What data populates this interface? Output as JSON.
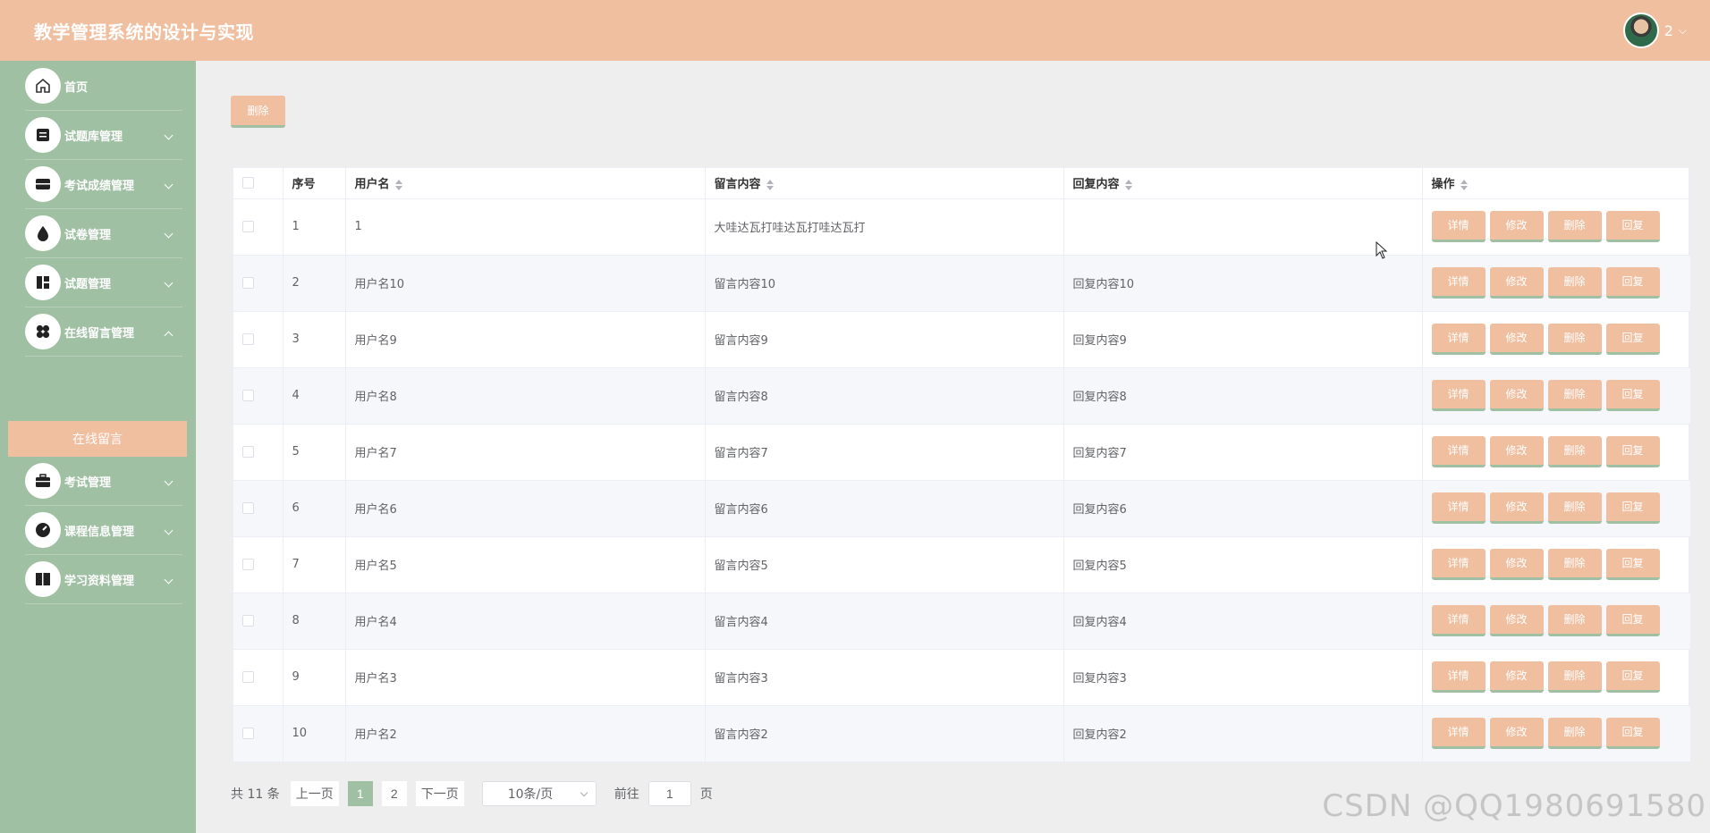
{
  "header": {
    "title": "教学管理系统的设计与实现",
    "user_name": "2",
    "user_caret": "⌵"
  },
  "sidebar": {
    "items": [
      {
        "label": "首页",
        "icon": "home-icon"
      },
      {
        "label": "试题库管理",
        "icon": "database-icon"
      },
      {
        "label": "考试成绩管理",
        "icon": "tray-icon"
      },
      {
        "label": "试卷管理",
        "icon": "drop-icon"
      },
      {
        "label": "试题管理",
        "icon": "layout-icon"
      },
      {
        "label": "在线留言管理",
        "icon": "clover-icon"
      },
      {
        "label": "考试管理",
        "icon": "briefcase-icon"
      },
      {
        "label": "课程信息管理",
        "icon": "gauge-icon"
      },
      {
        "label": "学习资料管理",
        "icon": "panel-icon"
      }
    ],
    "sub_item": "在线留言"
  },
  "toolbar": {
    "delete_label": "删除"
  },
  "table": {
    "headers": {
      "index": "序号",
      "username": "用户名",
      "message": "留言内容",
      "reply": "回复内容",
      "ops": "操作"
    },
    "rows": [
      {
        "index": "1",
        "username": "1",
        "message": "大哇达瓦打哇达瓦打哇达瓦打",
        "reply": ""
      },
      {
        "index": "2",
        "username": "用户名10",
        "message": "留言内容10",
        "reply": "回复内容10"
      },
      {
        "index": "3",
        "username": "用户名9",
        "message": "留言内容9",
        "reply": "回复内容9"
      },
      {
        "index": "4",
        "username": "用户名8",
        "message": "留言内容8",
        "reply": "回复内容8"
      },
      {
        "index": "5",
        "username": "用户名7",
        "message": "留言内容7",
        "reply": "回复内容7"
      },
      {
        "index": "6",
        "username": "用户名6",
        "message": "留言内容6",
        "reply": "回复内容6"
      },
      {
        "index": "7",
        "username": "用户名5",
        "message": "留言内容5",
        "reply": "回复内容5"
      },
      {
        "index": "8",
        "username": "用户名4",
        "message": "留言内容4",
        "reply": "回复内容4"
      },
      {
        "index": "9",
        "username": "用户名3",
        "message": "留言内容3",
        "reply": "回复内容3"
      },
      {
        "index": "10",
        "username": "用户名2",
        "message": "留言内容2",
        "reply": "回复内容2"
      }
    ],
    "op_labels": {
      "detail": "详情",
      "edit": "修改",
      "delete": "删除",
      "reply": "回复"
    }
  },
  "pagination": {
    "total": "共 11 条",
    "prev": "上一页",
    "pages": [
      "1",
      "2"
    ],
    "current": "1",
    "next": "下一页",
    "page_size": "10条/页",
    "goto_label": "前往",
    "goto_value": "1",
    "page_unit": "页"
  },
  "watermark": "CSDN @QQ1980691580",
  "colors": {
    "header": "#f0bfa0",
    "sidebar": "#a0c0a4",
    "button": "#f0bfa0",
    "active_page": "#a0c0a4"
  }
}
